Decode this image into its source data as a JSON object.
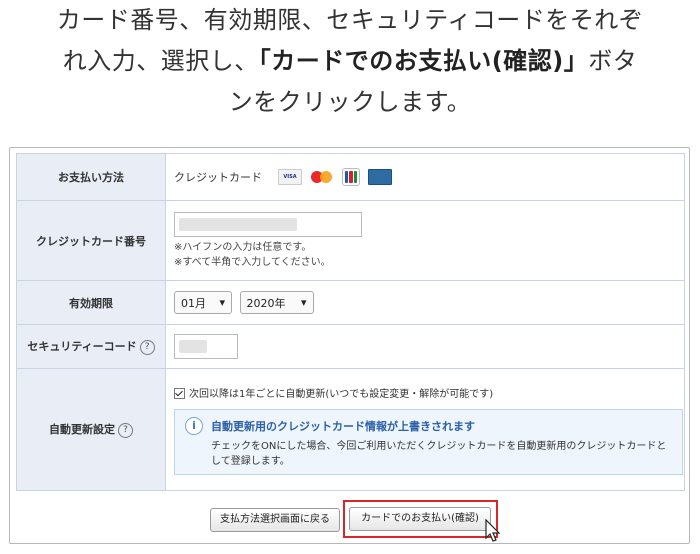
{
  "instructions": {
    "line1": "カード番号、有効期限、セキュリティコードをそれぞ",
    "line2_pre": "れ入力、選択し、",
    "line2_bold": "「カードでのお支払い(確認)」",
    "line2_post": "ボタ",
    "line3": "ンをクリックします。"
  },
  "form": {
    "payment_method": {
      "label": "お支払い方法",
      "value": "クレジットカード",
      "card_icons": [
        "visa-icon",
        "mastercard-icon",
        "jcb-icon",
        "amex-icon"
      ]
    },
    "card_number": {
      "label": "クレジットカード番号",
      "note1": "※ハイフンの入力は任意です。",
      "note2": "※すべて半角で入力してください。"
    },
    "expiry": {
      "label": "有効期限",
      "month": "01月",
      "year": "2020年",
      "arrow": "▾"
    },
    "security_code": {
      "label": "セキュリティーコード",
      "help": "?"
    },
    "auto_renew": {
      "label": "自動更新設定",
      "help": "?",
      "checkbox_label": "次回以降は1年ごとに自動更新(いつでも設定変更・解除が可能です)",
      "checked": true,
      "info_icon": "i",
      "info_title": "自動更新用のクレジットカード情報が上書きされます",
      "info_text": "チェックをONにした場合、今回ご利用いただくクレジットカードを自動更新用のクレジットカードとして登録します。"
    }
  },
  "buttons": {
    "back_label": "支払方法選択画面に戻る",
    "confirm_label": "カードでのお支払い(確認)"
  },
  "colors": {
    "highlight": "#d9262b",
    "label_bg": "#e9eef6",
    "info_title": "#2a5fa8"
  }
}
